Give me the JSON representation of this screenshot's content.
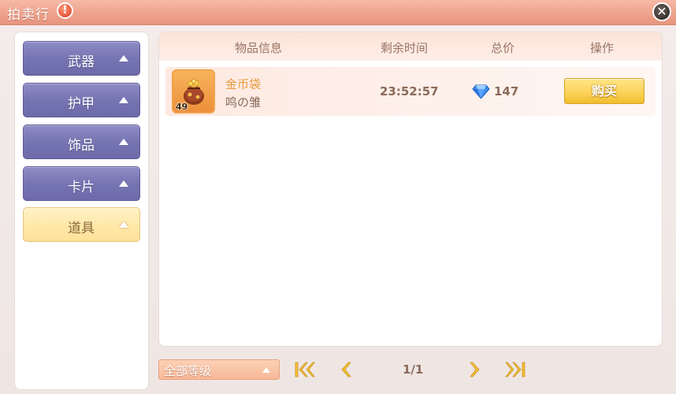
{
  "window": {
    "title": "拍卖行",
    "help_glyph": "!",
    "close_glyph": "✕"
  },
  "categories": [
    {
      "label": "武器",
      "active": false
    },
    {
      "label": "护甲",
      "active": false
    },
    {
      "label": "饰品",
      "active": false
    },
    {
      "label": "卡片",
      "active": false
    },
    {
      "label": "道具",
      "active": true
    }
  ],
  "table": {
    "headers": {
      "item_info": "物品信息",
      "time_left": "剩余时间",
      "total_price": "总价",
      "action": "操作"
    },
    "rows": [
      {
        "item_name": "金币袋",
        "seller": "鸣の雏",
        "quantity": "49",
        "time_left": "23:52:57",
        "price": "147",
        "currency_icon": "diamond-icon",
        "action_label": "购买"
      }
    ]
  },
  "footer": {
    "level_filter": "全部等级",
    "page_indicator": "1/1"
  },
  "colors": {
    "title_bar": "#eea38d",
    "category_button": "#7675b3",
    "category_active": "#ffe7a6",
    "buy_button": "#fcd35a",
    "item_name": "#e89a3c"
  }
}
